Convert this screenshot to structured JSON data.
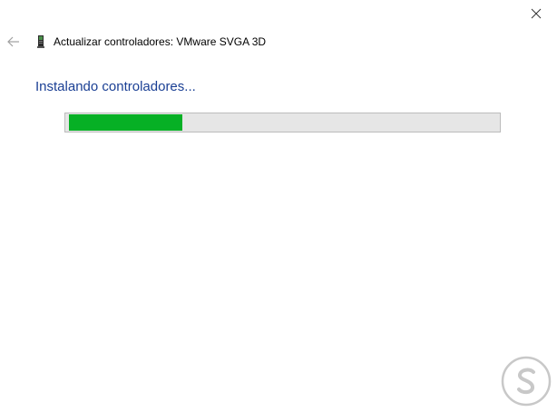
{
  "window": {
    "title": "Actualizar controladores: VMware SVGA 3D"
  },
  "icons": {
    "close": "close-icon",
    "back": "back-arrow-icon",
    "device": "display-adapter-icon",
    "watermark": "solvetic-logo"
  },
  "status": {
    "text": "Instalando controladores..."
  },
  "progress": {
    "fraction": 0.265,
    "fill_color": "#06b025",
    "track_color": "#e6e6e6"
  },
  "colors": {
    "status_text": "#1a3f94",
    "background": "#ffffff"
  }
}
